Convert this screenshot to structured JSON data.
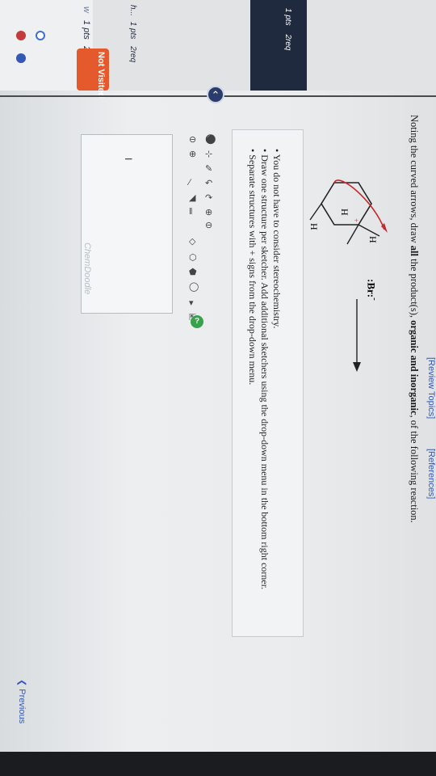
{
  "sidebar": {
    "questions": [
      {
        "label": "1 pts",
        "attempts": "2req",
        "status": "incorrect"
      },
      {
        "label": "1 pts",
        "attempts": "2req",
        "status": "not-visited"
      },
      {
        "label": "1 pts",
        "attempts": "2req",
        "status": "default"
      }
    ],
    "partial_first": "w",
    "partial_third": "h...",
    "status_label": "Not Visited"
  },
  "header": {
    "review_topics": "[Review Topics]",
    "references": "[References]"
  },
  "question": {
    "prompt_start": "Noting the curved arrows, draw ",
    "prompt_all": "all",
    "prompt_mid": " the product(s), ",
    "prompt_bold": "organic and inorganic",
    "prompt_end": ", of the following reaction."
  },
  "reaction": {
    "atom_h1": "H",
    "atom_h2": "H",
    "atom_h3": "H",
    "bromide": ":Br:",
    "bromide_charge": "-",
    "plus": "+"
  },
  "instructions": [
    "You do not have to consider stereochemistry.",
    "Draw one structure per sketcher. Add additional sketchers using the drop-down menu in the bottom right corner.",
    "Separate structures with + signs from the drop-down menu."
  ],
  "sketcher": {
    "brand": "ChemDoodle",
    "cursor": "I",
    "help": "?"
  },
  "nav": {
    "previous": "Previous"
  },
  "colors": {
    "nav_dark": "#1f2a3f",
    "not_visited": "#e55a2c",
    "incorrect": "#c43b3b",
    "link_blue": "#3359b5",
    "arrow_red": "#c8282d",
    "help_green": "#37a24b"
  }
}
